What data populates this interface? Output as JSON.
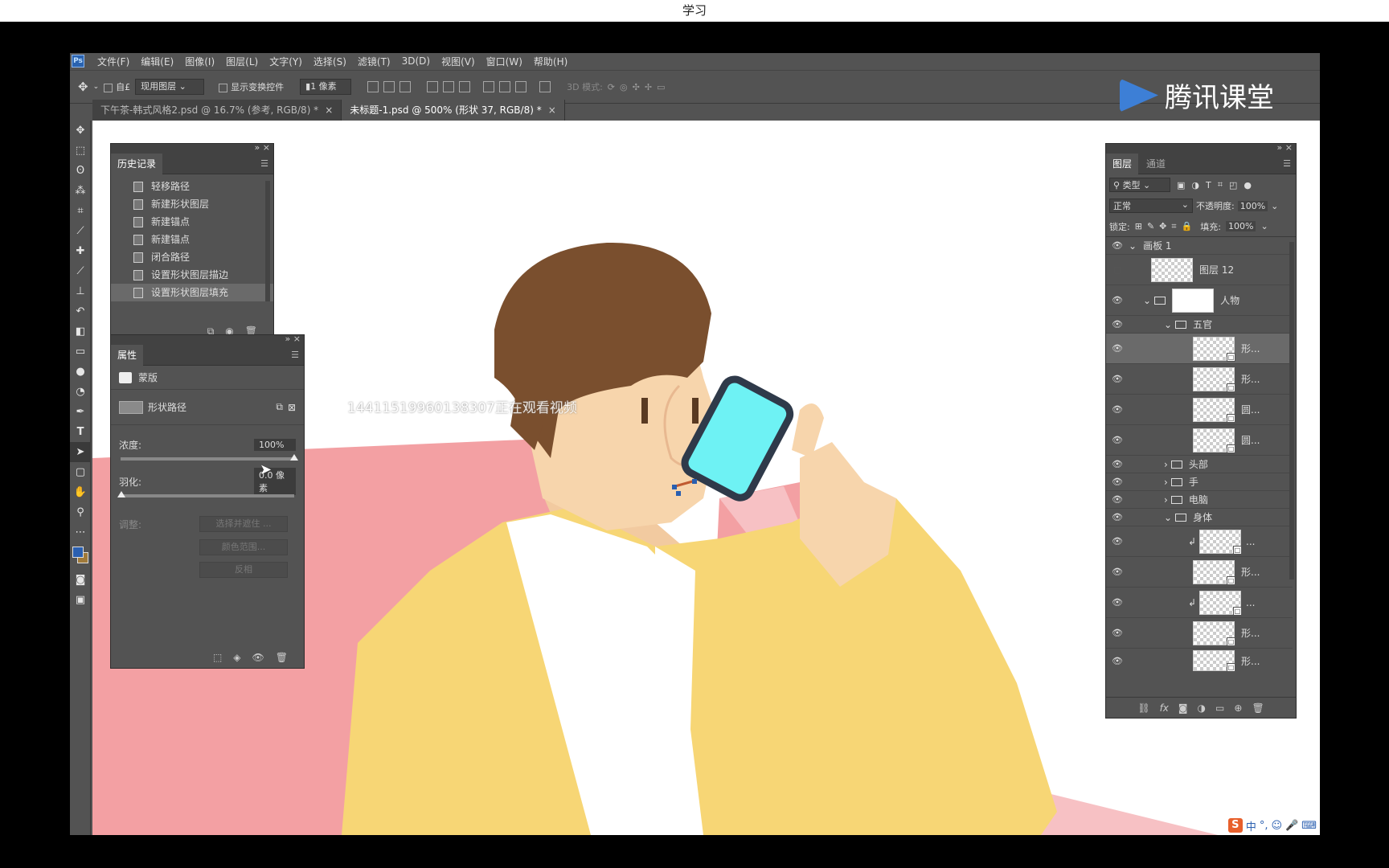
{
  "screen_title": "学习",
  "app": {
    "logo": "Ps",
    "menu": [
      "文件(F)",
      "编辑(E)",
      "图像(I)",
      "图层(L)",
      "文字(Y)",
      "选择(S)",
      "滤镜(T)",
      "3D(D)",
      "视图(V)",
      "窗口(W)",
      "帮助(H)"
    ]
  },
  "options_bar": {
    "auto_select_label": "自£",
    "layer_select": "现用图层",
    "show_transform": "显示变换控件",
    "stroke_width": "1 像素",
    "mode_3d": "3D 模式:"
  },
  "doc_tabs": [
    {
      "label": "下午茶-韩式风格2.psd @ 16.7% (参考, RGB/8) *",
      "close": "×",
      "active": false
    },
    {
      "label": "未标题-1.psd @ 500% (形状 37, RGB/8) *",
      "close": "×",
      "active": true
    }
  ],
  "tools": [
    "move-tool",
    "marquee-tool",
    "lasso-tool",
    "magic-wand-tool",
    "crop-tool",
    "eyedropper-tool",
    "healing-brush-tool",
    "brush-tool",
    "stamp-tool",
    "history-brush-tool",
    "eraser-tool",
    "gradient-tool",
    "blur-tool",
    "dodge-tool",
    "pen-tool",
    "type-tool",
    "path-selection-tool",
    "shape-tool",
    "hand-tool",
    "zoom-tool",
    "more-tool"
  ],
  "history_panel": {
    "title": "历史记录",
    "items": [
      "轻移路径",
      "新建形状图层",
      "新建锚点",
      "新建锚点",
      "闭合路径",
      "设置形状图层描边",
      "设置形状图层填充"
    ],
    "selected_index": 6
  },
  "properties_panel": {
    "title": "属性",
    "section": "蒙版",
    "shape_path_label": "形状路径",
    "density_label": "浓度:",
    "density_value": "100%",
    "density_fraction": 1.0,
    "feather_label": "羽化:",
    "feather_value": "0.0 像素",
    "adjust_label": "调整:",
    "btn_select_mask": "选择并遮住 ...",
    "btn_color_range": "颜色范围...",
    "btn_invert": "反相"
  },
  "layers_panel": {
    "tab_layers": "图层",
    "tab_channels": "通道",
    "filter_kind": "类型",
    "blend_mode": "正常",
    "opacity_label": "不透明度:",
    "opacity_value": "100%",
    "lock_label": "锁定:",
    "fill_label": "填充:",
    "fill_value": "100%",
    "layers": [
      {
        "name": "画板 1",
        "type": "artboard",
        "visible": true
      },
      {
        "name": "图层 12",
        "type": "layer",
        "visible": false
      },
      {
        "name": "人物",
        "type": "group",
        "visible": true
      },
      {
        "name": "五官",
        "type": "group",
        "visible": true
      },
      {
        "name": "形...",
        "type": "shape",
        "visible": true,
        "selected": true
      },
      {
        "name": "形...",
        "type": "shape",
        "visible": true
      },
      {
        "name": "圆...",
        "type": "shape",
        "visible": true
      },
      {
        "name": "圆...",
        "type": "shape",
        "visible": true
      },
      {
        "name": "头部",
        "type": "group",
        "visible": true
      },
      {
        "name": "手",
        "type": "group",
        "visible": true
      },
      {
        "name": "电脑",
        "type": "group",
        "visible": true
      },
      {
        "name": "身体",
        "type": "group",
        "visible": true
      },
      {
        "name": "...",
        "type": "clip",
        "visible": true
      },
      {
        "name": "形...",
        "type": "shape",
        "visible": true
      },
      {
        "name": "...",
        "type": "clip",
        "visible": true
      },
      {
        "name": "形...",
        "type": "shape",
        "visible": true
      },
      {
        "name": "形...",
        "type": "shape",
        "visible": true
      }
    ]
  },
  "overlay": {
    "watermark_text": "14411519960138307正在观看视频",
    "brand": "腾讯课堂",
    "ime_text": "中",
    "ime_logo": "S"
  },
  "colors": {
    "ps_bg": "#535353",
    "canvas_bg": "#ffffff",
    "sofa_pink": "#f3a0a3",
    "jacket_yellow": "#f7d675",
    "skin": "#f7d5ac",
    "hair": "#7a4f2e",
    "phone": "#6ef2f4",
    "brand_blue": "#3d7fd6"
  }
}
